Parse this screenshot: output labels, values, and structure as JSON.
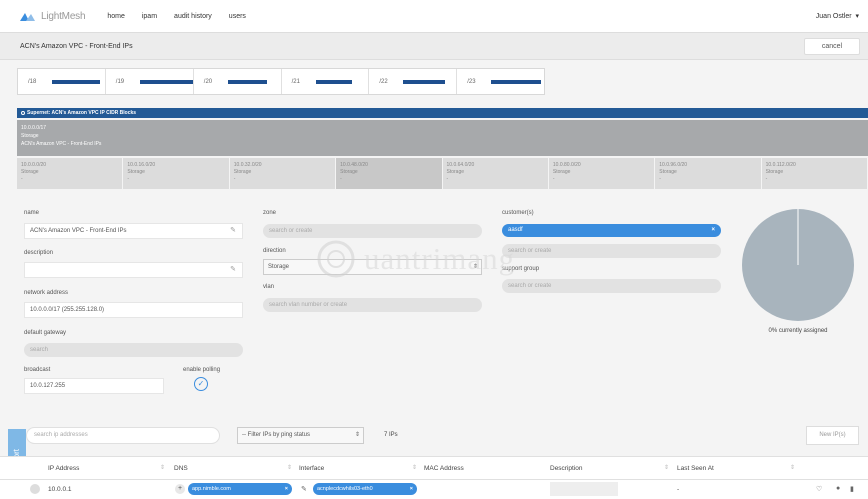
{
  "brand": {
    "name": "LightMesh",
    "accent": "#235a96"
  },
  "nav": {
    "items": [
      "home",
      "ipam",
      "audit history",
      "users"
    ],
    "user": "Juan Ostler"
  },
  "subheader": {
    "title": "ACN's Amazon VPC - Front-End IPs",
    "cancel_label": "cancel"
  },
  "prefix_bar": [
    {
      "label": "/18",
      "fill_fraction": 0.85
    },
    {
      "label": "/19",
      "fill_fraction": 0.95
    },
    {
      "label": "/20",
      "fill_fraction": 0.7
    },
    {
      "label": "/21",
      "fill_fraction": 0.65
    },
    {
      "label": "/22",
      "fill_fraction": 0.75
    },
    {
      "label": "/23",
      "fill_fraction": 0.9
    }
  ],
  "supernet": {
    "label": "Supernet: ACN's Amazon VPC IP CIDR Blocks"
  },
  "block": {
    "cidr": "10.0.0.0/17",
    "type": "Storage",
    "name": "ACN's Amazon VPC - Front-End IPs"
  },
  "subnets": [
    {
      "cidr": "10.0.0.0/20",
      "type": "Storage",
      "extra": "-"
    },
    {
      "cidr": "10.0.16.0/20",
      "type": "Storage",
      "extra": "-"
    },
    {
      "cidr": "10.0.32.0/20",
      "type": "Storage",
      "extra": "-"
    },
    {
      "cidr": "10.0.48.0/20",
      "type": "Storage",
      "extra": "-"
    },
    {
      "cidr": "10.0.64.0/20",
      "type": "Storage",
      "extra": "-"
    },
    {
      "cidr": "10.0.80.0/20",
      "type": "Storage",
      "extra": "-"
    },
    {
      "cidr": "10.0.96.0/20",
      "type": "Storage",
      "extra": "-"
    },
    {
      "cidr": "10.0.112.0/20",
      "type": "Storage",
      "extra": "-"
    }
  ],
  "form": {
    "name_label": "name",
    "name_value": "ACN's Amazon VPC - Front-End IPs",
    "description_label": "description",
    "description_value": "",
    "network_address_label": "network address",
    "network_address_value": "10.0.0.0/17 (255.255.128.0)",
    "default_gateway_label": "default gateway",
    "default_gateway_placeholder": "search",
    "broadcast_label": "broadcast",
    "broadcast_value": "10.0.127.255",
    "enable_polling_label": "enable polling",
    "zone_label": "zone",
    "zone_placeholder": "search or create",
    "direction_label": "direction",
    "direction_value": "Storage",
    "vlan_label": "vlan",
    "vlan_placeholder": "search vlan number or create",
    "customers_label": "customer(s)",
    "customer_tag": "aasdf",
    "customer_placeholder": "search or create",
    "support_group_label": "support group",
    "support_group_placeholder": "search or create"
  },
  "assignment": {
    "percent_assigned": 0,
    "label": "0% currently assigned"
  },
  "toolbar": {
    "search_placeholder": "search ip addresses",
    "filter_value": "-- Filter IPs by ping status",
    "ip_count": "7 IPs",
    "new_ip_label": "New IP(s)",
    "support_label": "Support"
  },
  "table": {
    "headers": [
      "IP Address",
      "DNS",
      "Interface",
      "MAC Address",
      "Description",
      "Last Seen At"
    ],
    "rows": [
      {
        "ip": "10.0.0.1",
        "dns": "app.nimble.com",
        "interface": "acnplecdcwhils03-eth0",
        "mac": "",
        "description": "",
        "last_seen": "-"
      }
    ]
  },
  "watermark": {
    "text": "uantrimang"
  }
}
